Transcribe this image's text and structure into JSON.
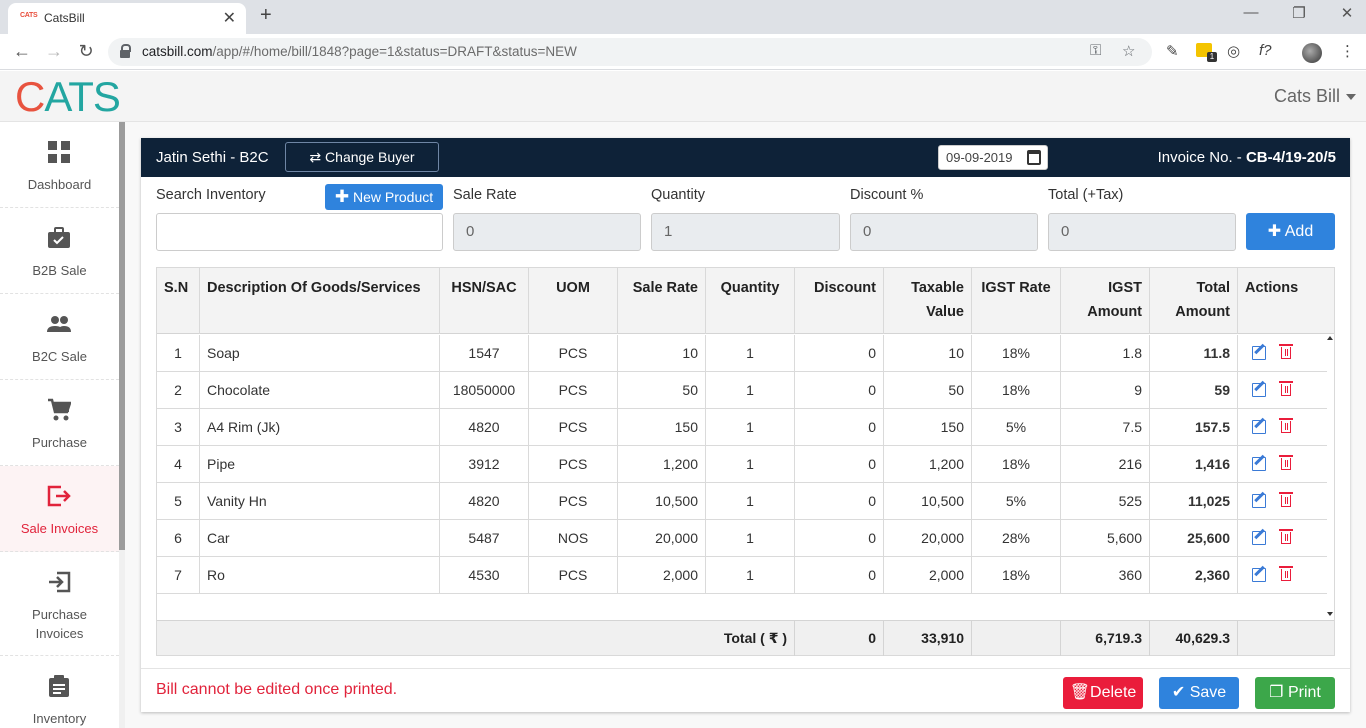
{
  "browser": {
    "tab_title": "CatsBill",
    "tab_favicon": "CATS",
    "url_host": "catsbill.com",
    "url_path": "/app/#/home/bill/1848?page=1&status=DRAFT&status=NEW"
  },
  "app": {
    "logo_c": "C",
    "logo_ats": "ATS",
    "user_menu": "Cats Bill"
  },
  "sidebar": {
    "items": [
      {
        "label": "Dashboard",
        "icon": "grid-icon",
        "active": false
      },
      {
        "label": "B2B Sale",
        "icon": "briefcase-icon",
        "active": false
      },
      {
        "label": "B2C Sale",
        "icon": "people-icon",
        "active": false
      },
      {
        "label": "Purchase",
        "icon": "cart-icon",
        "active": false
      },
      {
        "label": "Sale Invoices",
        "icon": "logout-icon",
        "active": true
      },
      {
        "label": "Purchase Invoices",
        "label_1": "Purchase",
        "label_2": "Invoices",
        "icon": "login-icon",
        "active": false
      },
      {
        "label": "Inventory",
        "icon": "clipboard-icon",
        "active": false
      }
    ]
  },
  "invoice": {
    "buyer": "Jatin Sethi - B2C",
    "change_buyer": "Change Buyer",
    "date": "09-09-2019",
    "invoice_label": "Invoice No. -",
    "invoice_no": "CB-4/19-20/5"
  },
  "form": {
    "search_label": "Search Inventory",
    "new_product": "New Product",
    "sale_rate_label": "Sale Rate",
    "sale_rate_value": "0",
    "quantity_label": "Quantity",
    "quantity_value": "1",
    "discount_label": "Discount %",
    "discount_value": "0",
    "total_label": "Total (+Tax)",
    "total_value": "0",
    "add_label": "Add"
  },
  "table": {
    "headers": {
      "sn": "S.N",
      "desc": "Description Of Goods/Services",
      "hsn": "HSN/SAC",
      "uom": "UOM",
      "rate": "Sale Rate",
      "qty": "Quantity",
      "discount": "Discount",
      "taxable_1": "Taxable",
      "taxable_2": "Value",
      "igst_rate": "IGST Rate",
      "igst_amt_1": "IGST",
      "igst_amt_2": "Amount",
      "total_1": "Total",
      "total_2": "Amount",
      "actions": "Actions"
    },
    "rows": [
      {
        "sn": "1",
        "desc": "Soap",
        "hsn": "1547",
        "uom": "PCS",
        "rate": "10",
        "qty": "1",
        "discount": "0",
        "taxable": "10",
        "igst_rate": "18%",
        "igst_amt": "1.8",
        "total": "11.8"
      },
      {
        "sn": "2",
        "desc": "Chocolate",
        "hsn": "18050000",
        "uom": "PCS",
        "rate": "50",
        "qty": "1",
        "discount": "0",
        "taxable": "50",
        "igst_rate": "18%",
        "igst_amt": "9",
        "total": "59"
      },
      {
        "sn": "3",
        "desc": "A4 Rim (Jk)",
        "hsn": "4820",
        "uom": "PCS",
        "rate": "150",
        "qty": "1",
        "discount": "0",
        "taxable": "150",
        "igst_rate": "5%",
        "igst_amt": "7.5",
        "total": "157.5"
      },
      {
        "sn": "4",
        "desc": "Pipe",
        "hsn": "3912",
        "uom": "PCS",
        "rate": "1,200",
        "qty": "1",
        "discount": "0",
        "taxable": "1,200",
        "igst_rate": "18%",
        "igst_amt": "216",
        "total": "1,416"
      },
      {
        "sn": "5",
        "desc": "Vanity Hn",
        "hsn": "4820",
        "uom": "PCS",
        "rate": "10,500",
        "qty": "1",
        "discount": "0",
        "taxable": "10,500",
        "igst_rate": "5%",
        "igst_amt": "525",
        "total": "11,025"
      },
      {
        "sn": "6",
        "desc": "Car",
        "hsn": "5487",
        "uom": "NOS",
        "rate": "20,000",
        "qty": "1",
        "discount": "0",
        "taxable": "20,000",
        "igst_rate": "28%",
        "igst_amt": "5,600",
        "total": "25,600"
      },
      {
        "sn": "7",
        "desc": "Ro",
        "hsn": "4530",
        "uom": "PCS",
        "rate": "2,000",
        "qty": "1",
        "discount": "0",
        "taxable": "2,000",
        "igst_rate": "18%",
        "igst_amt": "360",
        "total": "2,360"
      }
    ],
    "totals": {
      "label": "Total ( ₹ )",
      "discount": "0",
      "taxable": "33,910",
      "igst_amt": "6,719.3",
      "total": "40,629.3"
    }
  },
  "footer": {
    "warning": "Bill cannot be edited once printed.",
    "delete": "Delete",
    "save": "Save",
    "print": "Print"
  },
  "colors": {
    "header_navy": "#0e2238",
    "primary_blue": "#2f83dd",
    "danger_red": "#ea1d3b",
    "success_green": "#3ca74a",
    "active_red": "#e1233b"
  }
}
